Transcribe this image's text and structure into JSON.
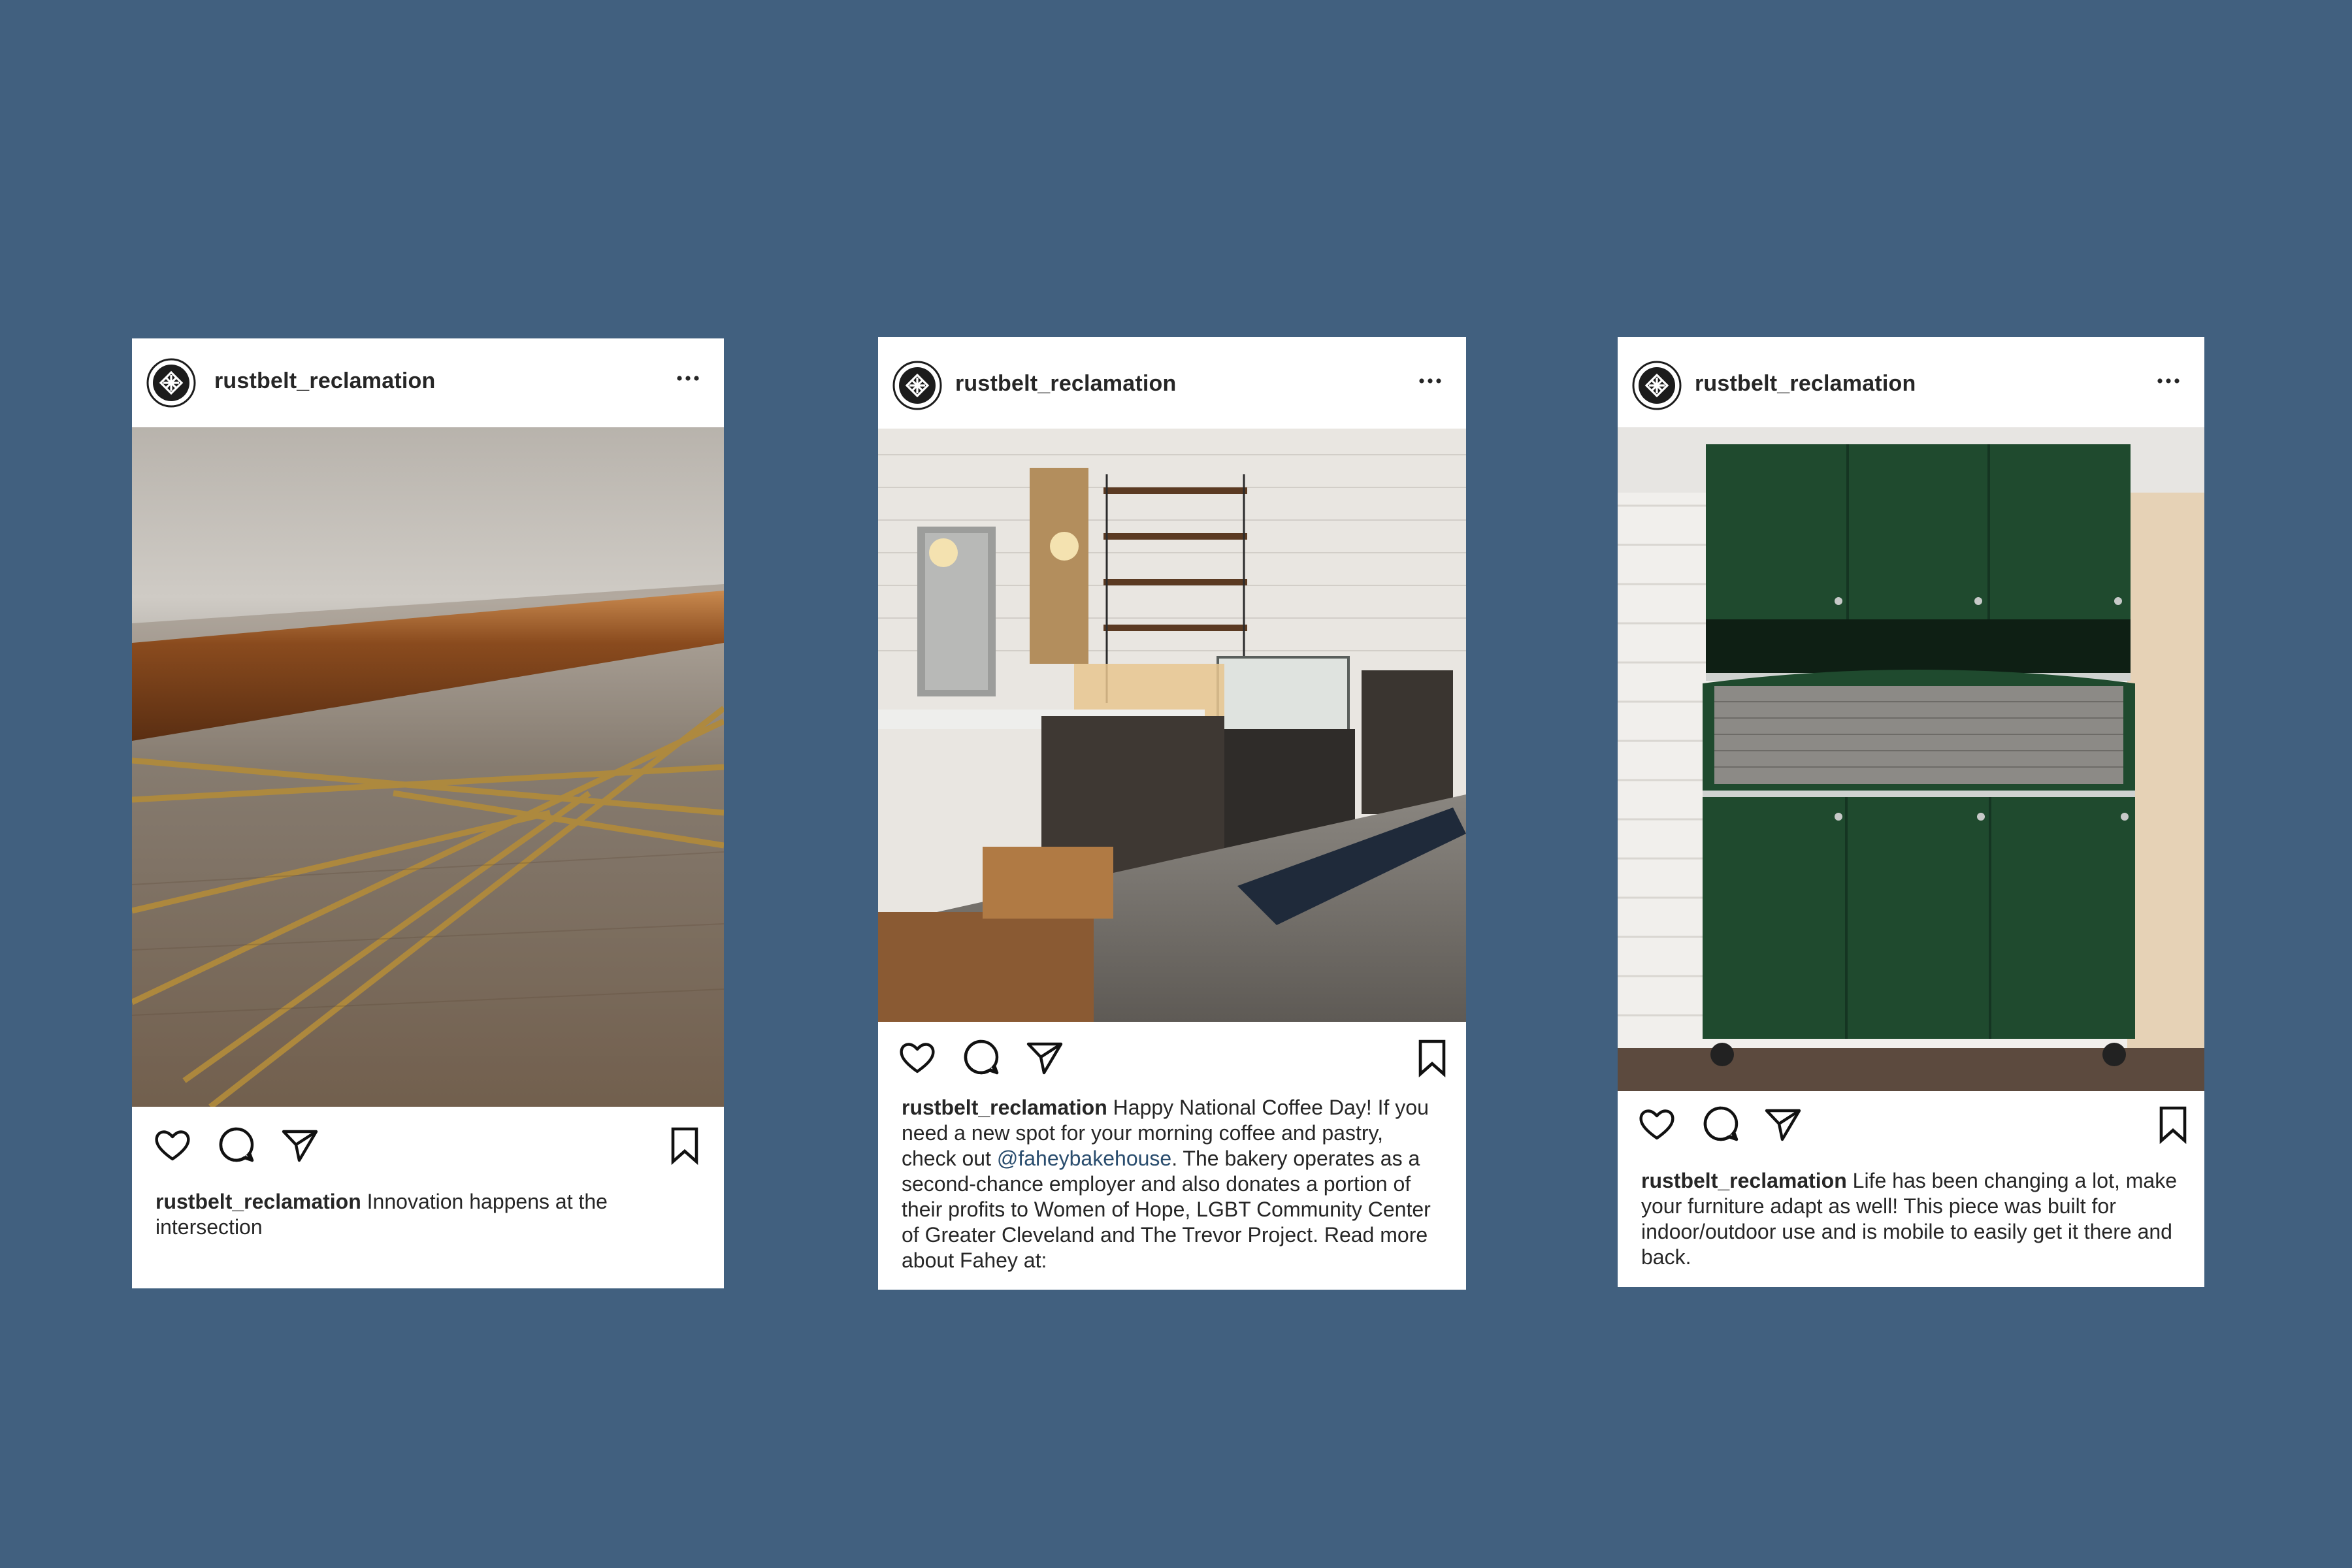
{
  "posts": [
    {
      "username": "rustbelt_reclamation",
      "caption_user": "rustbelt_reclamation",
      "caption_text": " Innovation happens at the intersection",
      "photo_icon": "table-edge-photo"
    },
    {
      "username": "rustbelt_reclamation",
      "caption_user": "rustbelt_reclamation",
      "caption_text_1": " Happy National Coffee Day! If you need a new spot for your morning coffee and pastry, check out ",
      "caption_mention": "@faheybakehouse",
      "caption_text_2": ". The bakery operates as a second-chance employer and also donates a portion of their profits to Women of Hope, LGBT Community Center of Greater Cleveland and The Trevor Project. Read more about Fahey at:",
      "photo_icon": "bakery-interior-photo"
    },
    {
      "username": "rustbelt_reclamation",
      "caption_user": "rustbelt_reclamation",
      "caption_text": " Life has been changing a lot, make your furniture adapt as well! This piece was built for indoor/outdoor use and is mobile to easily get it there and back.",
      "photo_icon": "green-cabinet-photo"
    }
  ],
  "colors": {
    "background": "#41607f",
    "card": "#ffffff",
    "text": "#262626",
    "mention": "#2a4d6e"
  },
  "icons": [
    "logo-avatar-icon",
    "more-options-icon",
    "heart-icon",
    "comment-icon",
    "share-icon",
    "bookmark-icon"
  ]
}
